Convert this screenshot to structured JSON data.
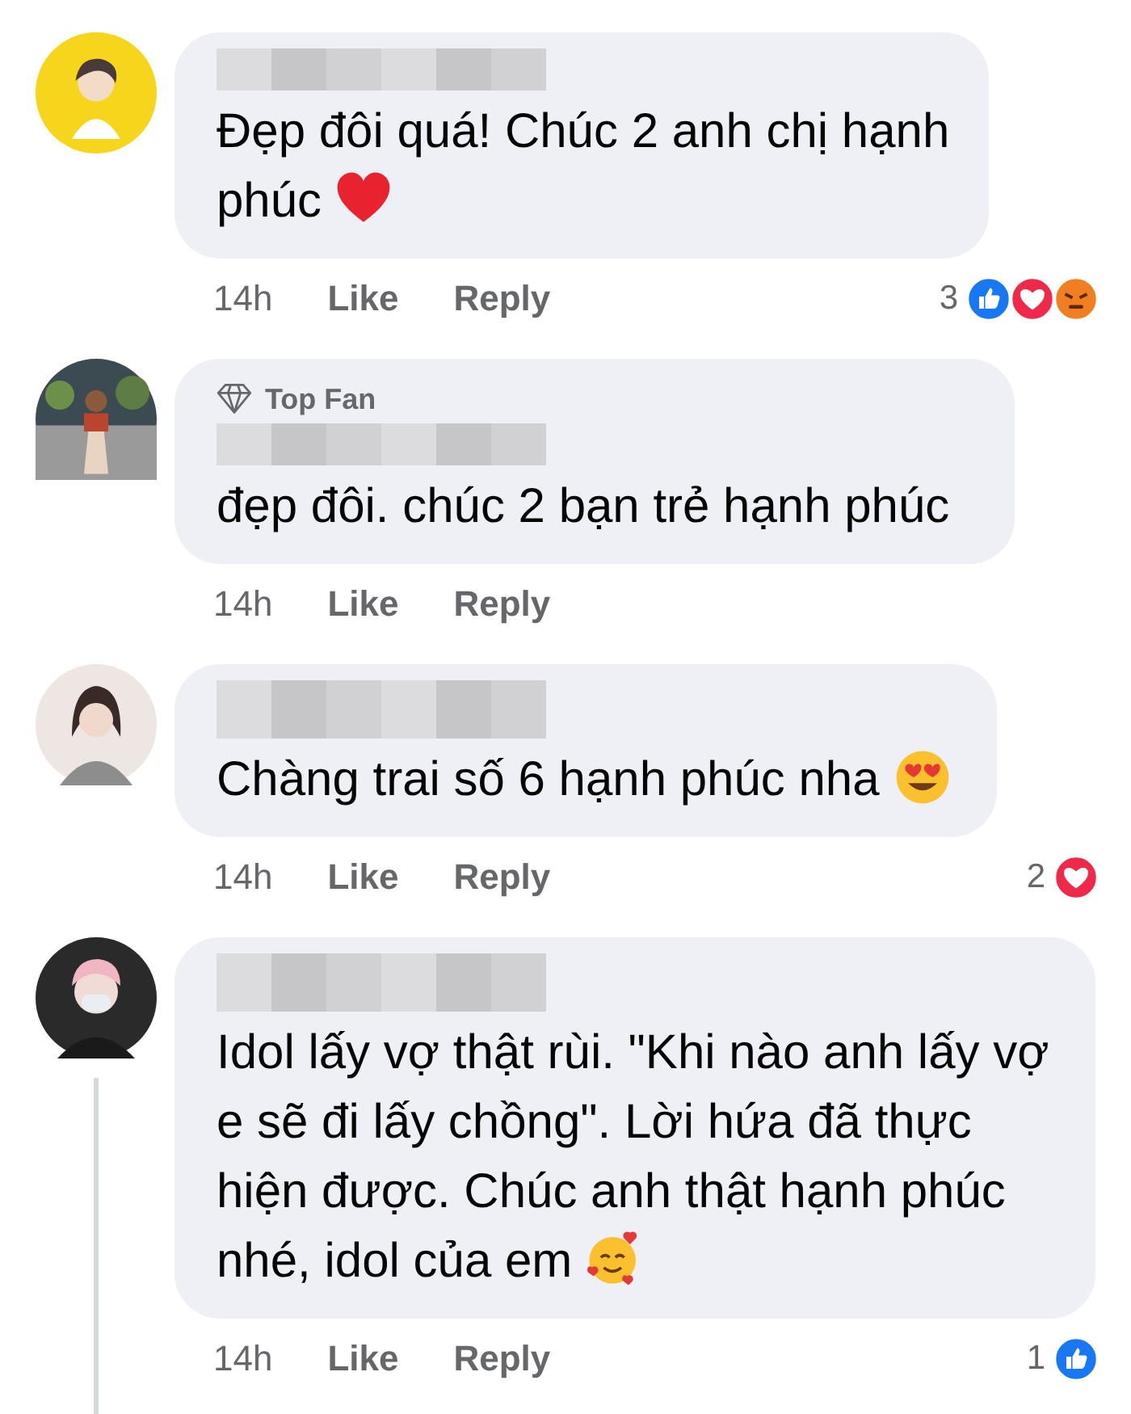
{
  "comments": [
    {
      "avatar": {
        "kind": "picture"
      },
      "text": "Đẹp đôi quá! Chúc 2 anh chị hạnh phúc",
      "emoji": {
        "kind": "heart"
      },
      "time": "14h",
      "like": "Like",
      "reply": "Reply",
      "reaction_count": "3",
      "reactions": [
        {
          "kind": "like"
        },
        {
          "kind": "love"
        },
        {
          "kind": "angry"
        }
      ],
      "thread": false
    },
    {
      "avatar": {
        "kind": "picture"
      },
      "badge": "Top Fan",
      "text": "đẹp đôi. chúc 2 bạn trẻ hạnh phúc",
      "time": "14h",
      "like": "Like",
      "reply": "Reply",
      "thread": false
    },
    {
      "avatar": {
        "kind": "picture"
      },
      "text": "Chàng trai số 6 hạnh phúc nha",
      "emoji": {
        "kind": "heart-eyes"
      },
      "time": "14h",
      "like": "Like",
      "reply": "Reply",
      "reaction_count": "2",
      "reactions": [
        {
          "kind": "love"
        }
      ],
      "thread": false
    },
    {
      "avatar": {
        "kind": "picture"
      },
      "text": "Idol lấy vợ thật rùi. \"Khi nào anh lấy vợ e sẽ đi lấy chồng\". Lời hứa đã thực hiện được. Chúc anh thật hạnh phúc nhé, idol của em",
      "emoji": {
        "kind": "smiling-hearts"
      },
      "time": "14h",
      "like": "Like",
      "reply": "Reply",
      "reaction_count": "1",
      "reactions": [
        {
          "kind": "like"
        }
      ],
      "thread": true
    }
  ]
}
